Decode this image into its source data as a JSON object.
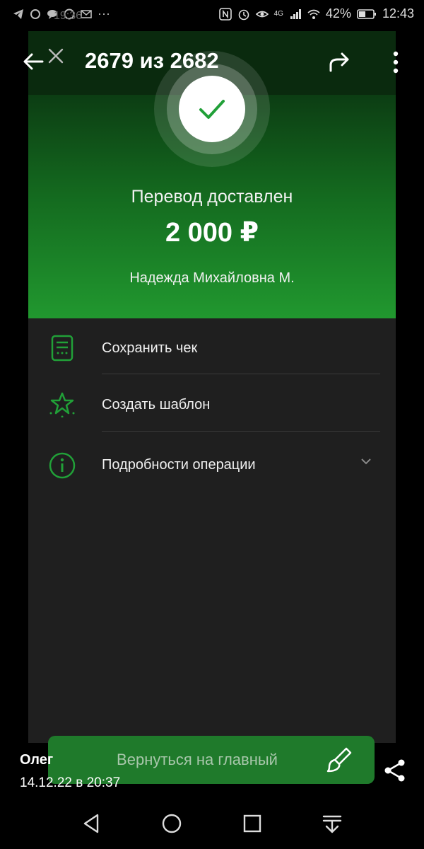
{
  "status_bar": {
    "ghost_time": "19:36",
    "battery": "42%",
    "time": "12:43",
    "network": "4G"
  },
  "viewer": {
    "counter": "2679 из 2682",
    "sender": "Олег",
    "datetime": "14.12.22 в 20:37"
  },
  "receipt": {
    "status_title": "Перевод доставлен",
    "amount": "2 000 ₽",
    "recipient": "Надежда Михайловна М."
  },
  "menu": [
    {
      "label": "Сохранить чек",
      "icon": "receipt-icon"
    },
    {
      "label": "Создать шаблон",
      "icon": "star-icon"
    },
    {
      "label": "Подробности операции",
      "icon": "info-icon"
    }
  ],
  "cta": {
    "label": "Вернуться на главный"
  },
  "colors": {
    "accent": "#21a038",
    "panel": "#1f1f1f"
  }
}
